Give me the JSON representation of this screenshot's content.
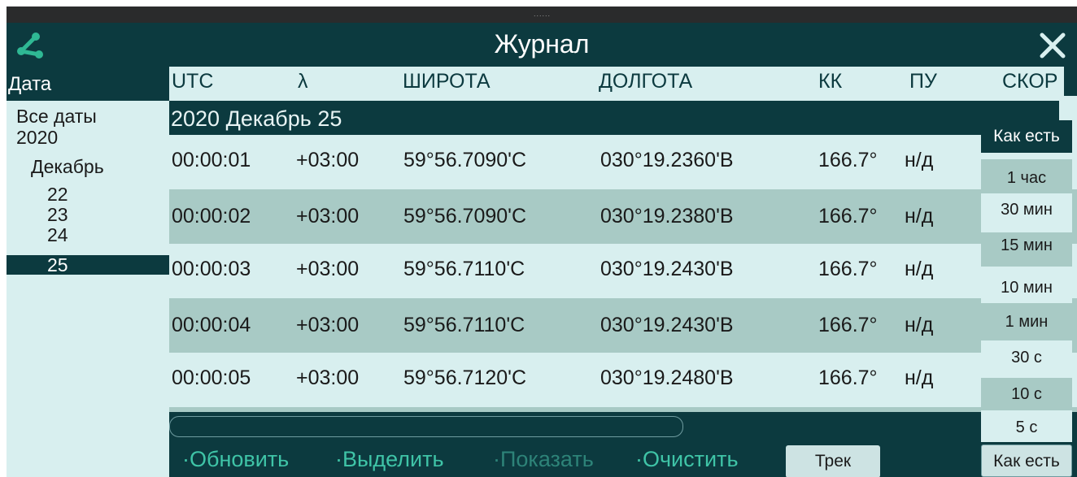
{
  "window": {
    "grip": "......",
    "title": "Журнал"
  },
  "sidebar": {
    "header": "Дата",
    "tree": {
      "all_dates": "Все даты",
      "year": "2020",
      "month": "Декабрь",
      "days": [
        "22",
        "23",
        "24",
        "25"
      ],
      "selected_day": "25"
    }
  },
  "table": {
    "columns": [
      "UTC",
      "λ",
      "ШИРОТА",
      "ДОЛГОТА",
      "КК",
      "ПУ",
      "СКОР"
    ],
    "group_label": "2020 Декабрь 25",
    "rows": [
      {
        "utc": "00:00:01",
        "tz": "+03:00",
        "lat": "59°56.7090'С",
        "lon": "030°19.2360'В",
        "kk": "166.7°",
        "pu": "н/д"
      },
      {
        "utc": "00:00:02",
        "tz": "+03:00",
        "lat": "59°56.7090'С",
        "lon": "030°19.2380'В",
        "kk": "166.7°",
        "pu": "н/д"
      },
      {
        "utc": "00:00:03",
        "tz": "+03:00",
        "lat": "59°56.7110'С",
        "lon": "030°19.2430'В",
        "kk": "166.7°",
        "pu": "н/д"
      },
      {
        "utc": "00:00:04",
        "tz": "+03:00",
        "lat": "59°56.7110'С",
        "lon": "030°19.2430'В",
        "kk": "166.7°",
        "pu": "н/д"
      },
      {
        "utc": "00:00:05",
        "tz": "+03:00",
        "lat": "59°56.7120'С",
        "lon": "030°19.2480'В",
        "kk": "166.7°",
        "pu": "н/д"
      }
    ]
  },
  "interval_menu": {
    "options": [
      "Как есть",
      "1 час",
      "30 мин",
      "15 мин",
      "10 мин",
      "1 мин",
      "30 с",
      "10 с",
      "5 с"
    ],
    "selected": "Как есть"
  },
  "toolbar": {
    "refresh": "·Обновить",
    "select": "·Выделить",
    "show": "·Показать",
    "clear": "·Очистить",
    "track": "Трек",
    "step_value": "Как есть"
  },
  "colors": {
    "dark_teal": "#0c3a3f",
    "light_cyan": "#d8efef",
    "row_alt": "#a8cac5",
    "action_green": "#3fc4a7"
  },
  "icons": {
    "share": "share-icon",
    "close": "close-icon"
  }
}
